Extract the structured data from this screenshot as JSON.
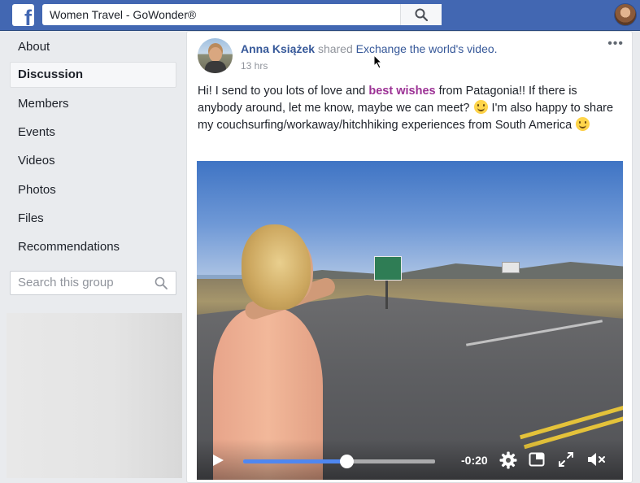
{
  "topbar": {
    "logo_letter": "f",
    "search_value": "Women Travel - GoWonder®"
  },
  "sidebar": {
    "items": [
      {
        "label": "About",
        "active": false
      },
      {
        "label": "Discussion",
        "active": true
      },
      {
        "label": "Members",
        "active": false
      },
      {
        "label": "Events",
        "active": false
      },
      {
        "label": "Videos",
        "active": false
      },
      {
        "label": "Photos",
        "active": false
      },
      {
        "label": "Files",
        "active": false
      },
      {
        "label": "Recommendations",
        "active": false
      }
    ],
    "group_search_placeholder": "Search this group"
  },
  "post": {
    "author": "Anna Książek",
    "shared_text": "shared",
    "shared_link": "Exchange the world's video.",
    "time": "13 hrs",
    "more": "•••",
    "text_part1": "Hi! I send to you lots of love and ",
    "text_highlight": "best wishes",
    "text_part2": " from Patagonia!! If there is anybody around, let me know, maybe we can meet? ",
    "text_part3": " I'm also happy to share my couchsurfing/workaway/hitchhiking experiences from South America ",
    "emoji": "slightly-smiling-face"
  },
  "video": {
    "time_remaining": "-0:20",
    "progress_percent": 54,
    "icons": [
      "play-icon",
      "settings-icon",
      "pip-icon",
      "fullscreen-icon",
      "volume-muted-icon"
    ]
  },
  "colors": {
    "brand": "#4267b2",
    "link": "#365899",
    "highlight": "#9c3295",
    "progress": "#4f87f0"
  }
}
